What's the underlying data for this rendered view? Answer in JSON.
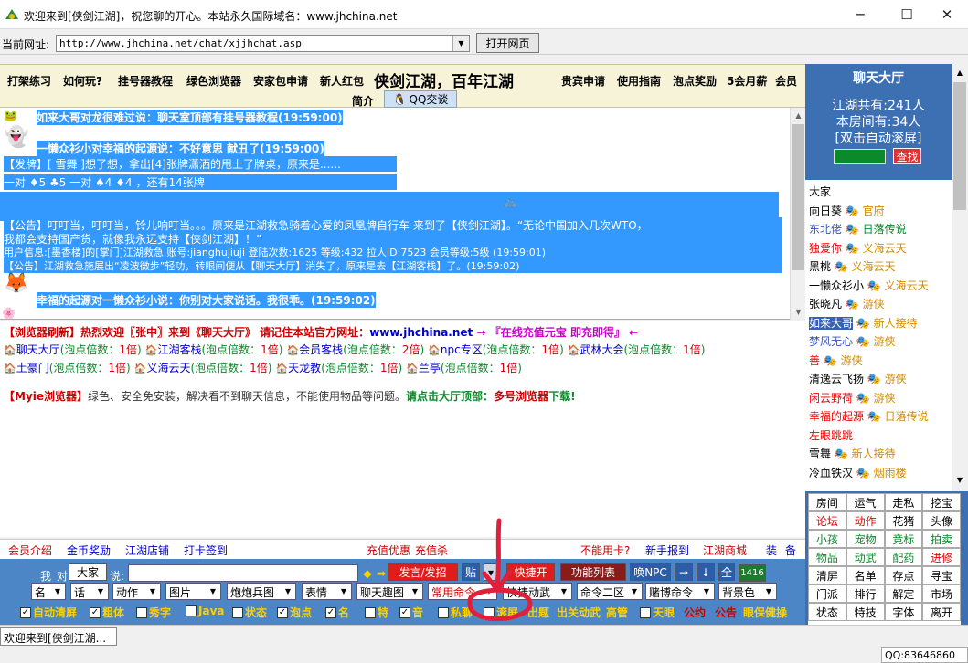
{
  "window": {
    "title": "欢迎来到[侠剑江湖]，祝您聊的开心。本站永久国际域名：www.jhchina.net",
    "minimize": "─",
    "maximize": "☐",
    "close": "✕"
  },
  "address": {
    "label": "当前网址:",
    "value": "http://www.jhchina.net/chat/xjjhchat.asp",
    "open_button": "打开网页"
  },
  "banner": {
    "links": [
      {
        "text": "打架练习",
        "color": "#0000cc"
      },
      {
        "text": "如何玩?",
        "color": "#cc0000"
      },
      {
        "text": "挂号器教程",
        "color": "#0000cc"
      },
      {
        "text": "绿色浏览器",
        "color": "#cc00cc"
      },
      {
        "text": "安家包申请",
        "color": "#cc0000"
      },
      {
        "text": "新人红包",
        "color": "#0000cc"
      },
      {
        "text": "侠剑江湖，百年江湖",
        "color": "#000000"
      },
      {
        "text": "贵宾申请",
        "color": "#cc0000"
      },
      {
        "text": "使用指南",
        "color": "#cc6600"
      },
      {
        "text": "泡点奖励",
        "color": "#cc00cc"
      },
      {
        "text": "5会月薪",
        "color": "#cc0000"
      },
      {
        "text": "会员",
        "color": "#0000cc"
      },
      {
        "text": "简介",
        "color": "#0000cc"
      }
    ],
    "qq_tab": "QQ交谈"
  },
  "chat": {
    "lines": [
      {
        "text": "如来大哥对龙很难过说：聊天室顶部有挂号器教程(19:59:00)",
        "hl": true
      },
      {
        "text": "一懒众衫小对幸福的起源说：不好意思  献丑了(19:59:00)",
        "hl": true
      },
      {
        "text": "【发牌】[ 雪舞 ]想了想，拿出[4]张牌潇洒的甩上了牌桌，原来是......",
        "hl": true
      },
      {
        "text": "一对 ♦5 ♣5 一对 ♠4 ♦4 ，还有14张牌",
        "hl": true
      },
      {
        "text": "【公告】叮叮当，叮叮当，铃儿响叮当。。。原来是江湖救急骑着心爱的凤凰牌自行车                     来到了【侠剑江湖】。“无论中国加入几次WTO，",
        "hl": true
      },
      {
        "text": "我都会支持国产货，就像我永远支持【侠剑江湖】！”",
        "hl": true
      },
      {
        "text": "用户信息:[墨香楼]的[掌门]江湖救急 账号:jianghujiuji 登陆次数:1625 等级:432 拉人ID:7523 会员等级:5级 (19:59:01)",
        "hl": true
      },
      {
        "text": "【公告】江湖救急施展出“凌波微步”轻功，转眼间便从【聊天大厅】消失了，原来是去【江湖客栈】了。(19:59:02)",
        "hl": true
      },
      {
        "text": "幸福的起源对一懒众衫小说：你别对大家说话。我很乖。(19:59:02)",
        "hl": true
      }
    ]
  },
  "lower": {
    "notice": {
      "p1": "【浏览器刷新】热烈欢迎〖张中〗来到《聊天大厅》 请记住本站官方网址：",
      "p2": "www.jhchina.net",
      "p3": " → 『在线充值元宝 即充即得』 ←"
    },
    "rooms": [
      {
        "name": "聊天大厅",
        "rate": "1倍"
      },
      {
        "name": "江湖客栈",
        "rate": "1倍"
      },
      {
        "name": "会员客栈",
        "rate": "2倍"
      },
      {
        "name": "npc专区",
        "rate": "1倍"
      },
      {
        "name": "武林大会",
        "rate": "1倍"
      },
      {
        "name": "土豪门",
        "rate": "1倍"
      },
      {
        "name": "义海云天",
        "rate": "1倍"
      },
      {
        "name": "天龙教",
        "rate": "1倍"
      },
      {
        "name": "兰亭",
        "rate": "1倍"
      }
    ],
    "rate_prefix": "(泡点倍数：",
    "rate_suffix": ")",
    "myie": {
      "p1": "【Myie浏览器】",
      "p2": "绿色、安全免安装，解决看不到聊天信息，不能使用物品等问题。",
      "p3": "请点击大厅顶部：",
      "p4": "多号浏览器",
      "p5": "下载!"
    }
  },
  "footer_links": [
    "会员介绍",
    "金币奖励",
    "江湖店铺",
    "打卡签到",
    "充值优惠",
    "充值杀",
    "不能用卡?",
    "新手报到",
    "江湖商城",
    "装",
    "备"
  ],
  "controls": {
    "me_label": "我",
    "to_label": "对",
    "target": "大家",
    "say_label": "说:",
    "send_button": "发言/发招",
    "paste_button": "贴",
    "shortcut_button": "快捷开",
    "function_button": "功能列表",
    "npc_button": "唤NPC",
    "all_button": "全",
    "count": "1416",
    "selects": [
      "名",
      "话",
      "动作",
      "图片",
      "炮炮兵图",
      "表情",
      "聊天趣图",
      "常用命令",
      "快捷动武",
      "命令二区",
      "赌博命令",
      "背景色"
    ],
    "checks": [
      {
        "label": "自动清屏",
        "checked": true
      },
      {
        "label": "粗体",
        "checked": true
      },
      {
        "label": "秀字",
        "checked": false
      },
      {
        "label": "Java",
        "checked": false
      },
      {
        "label": "状态",
        "checked": false
      },
      {
        "label": "泡点",
        "checked": true
      },
      {
        "label": "名",
        "checked": true
      },
      {
        "label": "特",
        "checked": false
      },
      {
        "label": "音",
        "checked": true
      },
      {
        "label": "私聊",
        "checked": false
      },
      {
        "label": "滚屏",
        "checked": false
      }
    ],
    "tail_links": [
      "出题",
      "出关动武",
      "高管",
      "天眼",
      "公约",
      "公告",
      "眼保健操"
    ]
  },
  "status": {
    "tab": "欢迎来到[侠剑江湖...",
    "qq": "QQ:83646860"
  },
  "sidebar": {
    "title": "聊天大厅",
    "stats": [
      "江湖共有:241人",
      "本房间有:34人",
      "[双击自动滚屏]"
    ],
    "search_button": "查找",
    "users": [
      {
        "name": "大家",
        "tag": "",
        "nc": "",
        "tc": ""
      },
      {
        "name": "向日葵",
        "tag": "官府",
        "nc": "",
        "tc": ""
      },
      {
        "name": "东北佬",
        "tag": "日落传说",
        "nc": "blue",
        "tc": "green"
      },
      {
        "name": "独爱你",
        "tag": "义海云天",
        "nc": "red",
        "tc": ""
      },
      {
        "name": "黑桃",
        "tag": "义海云天",
        "nc": "",
        "tc": ""
      },
      {
        "name": "一懒众衫小",
        "tag": "义海云天",
        "nc": "",
        "tc": ""
      },
      {
        "name": "张晓凡",
        "tag": "游侠",
        "nc": "",
        "tc": ""
      },
      {
        "name": "如来大哥",
        "tag": "新人接待",
        "nc": "hl2",
        "tc": ""
      },
      {
        "name": "梦风无心",
        "tag": "游侠",
        "nc": "blue",
        "tc": ""
      },
      {
        "name": "善",
        "tag": "游侠",
        "nc": "red",
        "tc": ""
      },
      {
        "name": "清逸云飞扬",
        "tag": "游侠",
        "nc": "",
        "tc": ""
      },
      {
        "name": "闲云野荷",
        "tag": "游侠",
        "nc": "red",
        "tc": ""
      },
      {
        "name": "幸福的起源",
        "tag": "日落传说",
        "nc": "red",
        "tc": ""
      },
      {
        "name": "左眼跳跳",
        "tag": "",
        "nc": "red",
        "tc": ""
      },
      {
        "name": "雪舞",
        "tag": "新人接待",
        "nc": "",
        "tc": ""
      },
      {
        "name": "冷血铁汉",
        "tag": "烟雨楼",
        "nc": "",
        "tc": ""
      }
    ],
    "grid": [
      {
        "t": "房间",
        "c": ""
      },
      {
        "t": "运气",
        "c": ""
      },
      {
        "t": "走私",
        "c": ""
      },
      {
        "t": "挖宝",
        "c": ""
      },
      {
        "t": "论坛",
        "c": "red"
      },
      {
        "t": "动作",
        "c": "red"
      },
      {
        "t": "花猪",
        "c": ""
      },
      {
        "t": "头像",
        "c": ""
      },
      {
        "t": "小孩",
        "c": "green"
      },
      {
        "t": "宠物",
        "c": "green"
      },
      {
        "t": "竞标",
        "c": "green"
      },
      {
        "t": "拍卖",
        "c": "green"
      },
      {
        "t": "物品",
        "c": "green"
      },
      {
        "t": "动武",
        "c": "green"
      },
      {
        "t": "配药",
        "c": "green"
      },
      {
        "t": "进修",
        "c": "red"
      },
      {
        "t": "清屏",
        "c": ""
      },
      {
        "t": "名单",
        "c": ""
      },
      {
        "t": "存点",
        "c": ""
      },
      {
        "t": "寻宝",
        "c": ""
      },
      {
        "t": "门派",
        "c": ""
      },
      {
        "t": "排行",
        "c": ""
      },
      {
        "t": "解定",
        "c": ""
      },
      {
        "t": "市场",
        "c": ""
      },
      {
        "t": "状态",
        "c": ""
      },
      {
        "t": "特技",
        "c": ""
      },
      {
        "t": "字体",
        "c": ""
      },
      {
        "t": "离开",
        "c": ""
      }
    ]
  }
}
